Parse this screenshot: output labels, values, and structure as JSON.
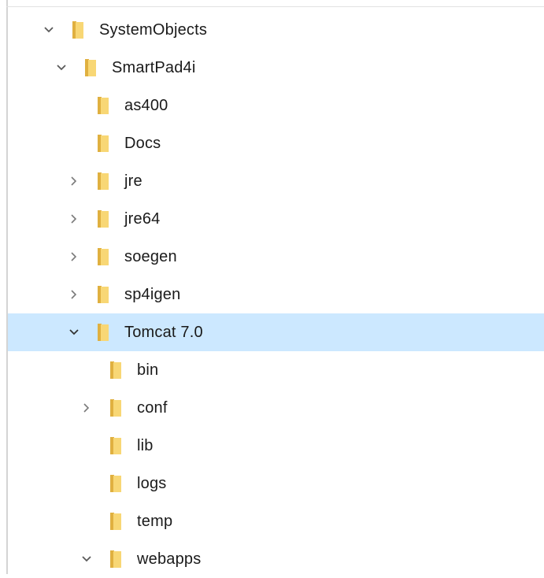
{
  "tree": {
    "items": [
      {
        "label": "SystemObjects",
        "state": "expanded",
        "icon": "folder-icon"
      },
      {
        "label": "SmartPad4i",
        "state": "expanded",
        "icon": "folder-icon"
      },
      {
        "label": "as400",
        "state": "leaf",
        "icon": "folder-icon"
      },
      {
        "label": "Docs",
        "state": "leaf",
        "icon": "folder-icon"
      },
      {
        "label": "jre",
        "state": "collapsed",
        "icon": "folder-icon"
      },
      {
        "label": "jre64",
        "state": "collapsed",
        "icon": "folder-icon"
      },
      {
        "label": "soegen",
        "state": "collapsed",
        "icon": "folder-icon"
      },
      {
        "label": "sp4igen",
        "state": "collapsed",
        "icon": "folder-icon"
      },
      {
        "label": "Tomcat 7.0",
        "state": "expanded",
        "selected": true,
        "icon": "folder-icon"
      },
      {
        "label": "bin",
        "state": "leaf",
        "icon": "folder-icon"
      },
      {
        "label": "conf",
        "state": "collapsed",
        "icon": "folder-icon"
      },
      {
        "label": "lib",
        "state": "leaf",
        "icon": "folder-icon"
      },
      {
        "label": "logs",
        "state": "leaf",
        "icon": "folder-icon"
      },
      {
        "label": "temp",
        "state": "leaf",
        "icon": "folder-icon"
      },
      {
        "label": "webapps",
        "state": "expanded",
        "icon": "folder-icon"
      }
    ]
  },
  "colors": {
    "selection": "#cce8ff",
    "folder_front": "#f8d775",
    "folder_back": "#e0b040",
    "chevron": "#5a5a5a",
    "text": "#1a1a1a"
  }
}
